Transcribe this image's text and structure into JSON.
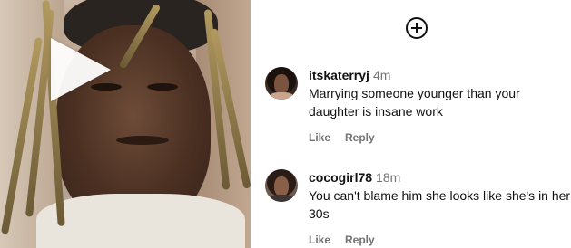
{
  "video": {
    "play_icon": "play-icon"
  },
  "header": {
    "add_icon": "add-circle-icon"
  },
  "comments": [
    {
      "username": "itskaterryj",
      "time": "4m",
      "text": "Marrying someone younger than your daughter is insane work",
      "like_label": "Like",
      "reply_label": "Reply"
    },
    {
      "username": "cocogirl78",
      "time": "18m",
      "text": "You can't blame him she looks like she's in her 30s",
      "like_label": "Like",
      "reply_label": "Reply"
    }
  ],
  "colors": {
    "meta_gray": "#737373",
    "text": "#111111"
  }
}
